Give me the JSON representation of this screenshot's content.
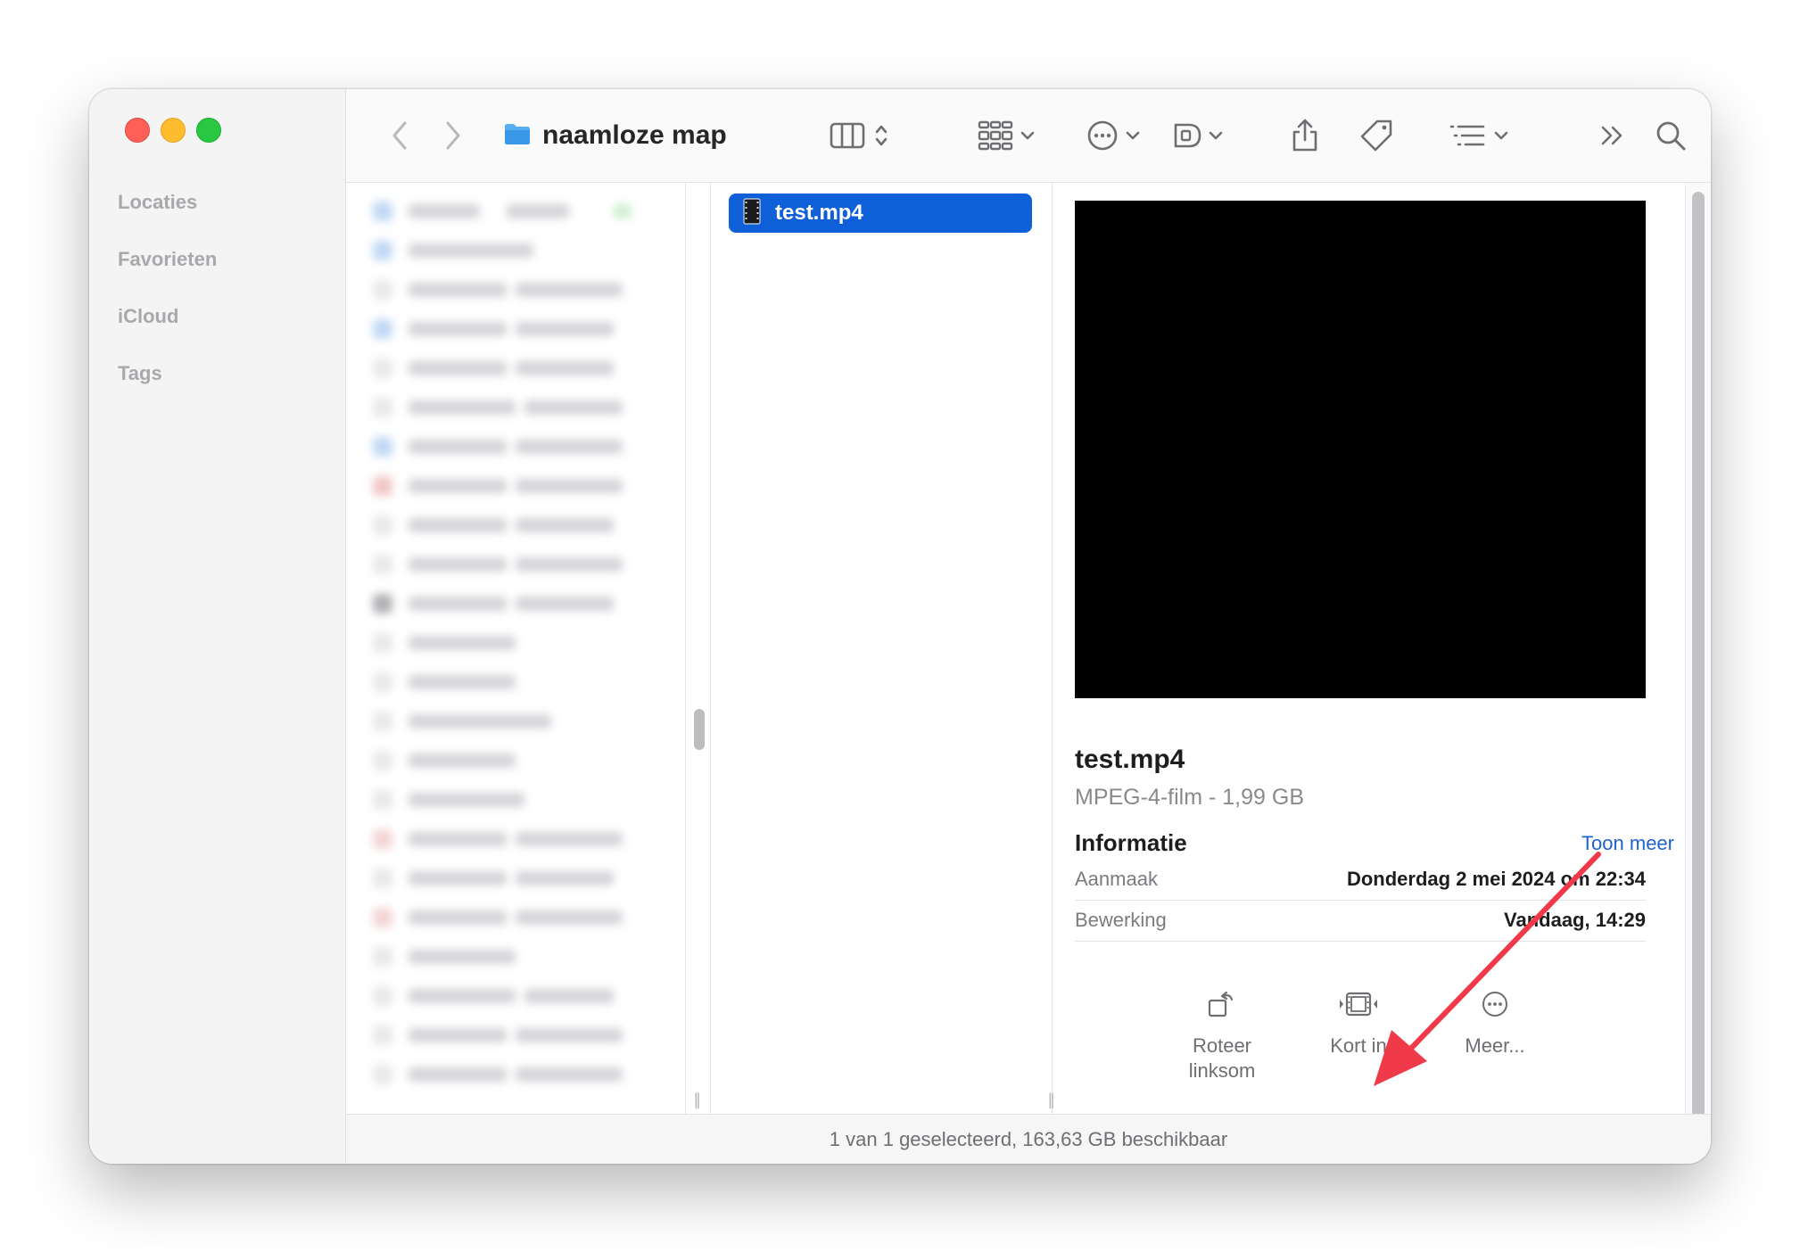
{
  "sidebar": {
    "sections": [
      {
        "label": "Locaties"
      },
      {
        "label": "Favorieten"
      },
      {
        "label": "iCloud"
      },
      {
        "label": "Tags"
      }
    ]
  },
  "toolbar": {
    "folder_name": "naamloze map",
    "icons": [
      "chevron-left-icon",
      "chevron-right-icon",
      "folder-icon",
      "columns-view-icon",
      "group-icon",
      "action-menu-icon",
      "edit-tags-icon",
      "share-icon",
      "tag-icon",
      "sort-list-icon",
      "more-toolbar-icon",
      "search-icon"
    ]
  },
  "columns": {
    "selected_file": "test.mp4"
  },
  "preview": {
    "title": "test.mp4",
    "subtitle": "MPEG-4-film - 1,99 GB",
    "info_heading": "Informatie",
    "show_more": "Toon meer",
    "rows": [
      {
        "key": "Aanmaak",
        "value": "Donderdag 2 mei 2024 om 22:34"
      },
      {
        "key": "Bewerking",
        "value": "Vandaag, 14:29"
      }
    ],
    "actions": [
      {
        "label_line1": "Roteer",
        "label_line2": "linksom"
      },
      {
        "label_line1": "Kort in",
        "label_line2": ""
      },
      {
        "label_line1": "Meer...",
        "label_line2": ""
      }
    ]
  },
  "status": {
    "text": "1 van 1 geselecteerd, 163,63 GB beschikbaar"
  },
  "colors": {
    "selection": "#0f5fd9",
    "link": "#1f63d1",
    "arrow": "#f03a4a"
  }
}
